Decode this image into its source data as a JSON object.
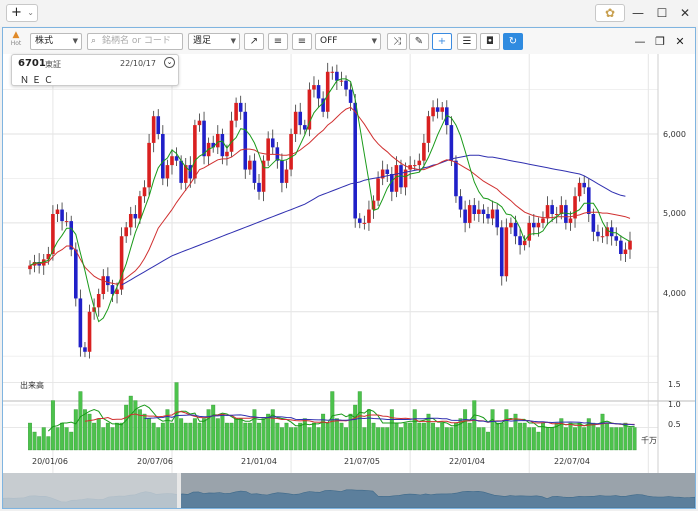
{
  "app": {
    "new_tab_label": "+",
    "window_buttons": [
      "—",
      "☐",
      "✕"
    ]
  },
  "toolbar": {
    "asset_type": "株式",
    "search_placeholder": "銘柄名 or コード",
    "period": "週足",
    "indicator": "OFF"
  },
  "info": {
    "code": "6701",
    "market": "東証",
    "date": "22/10/17",
    "name": "ＮＥＣ"
  },
  "axes": {
    "price_ticks": [
      "6,000",
      "5,000",
      "4,000"
    ],
    "volume_title": "出来高",
    "volume_ticks": [
      "1.5",
      "1.0",
      "0.5"
    ],
    "volume_unit": "千万",
    "date_ticks": [
      "20/01/06",
      "20/07/06",
      "21/01/04",
      "21/07/05",
      "22/01/04",
      "22/07/04"
    ]
  },
  "colors": {
    "up": "#d92020",
    "down": "#2020c8",
    "ma_short": "#1a9a1a",
    "ma_mid": "#d03030",
    "ma_long": "#3030b0",
    "volume": "#4cc24c",
    "accent": "#2f8be0"
  },
  "chart_data": {
    "type": "candlestick",
    "title": "",
    "xlabel": "",
    "ylabel": "",
    "ylim": [
      3300,
      6900
    ],
    "volume_ylim": [
      0,
      1.6
    ],
    "x_start": "2019-12-02",
    "x_end": "2022-10-17",
    "series": [
      {
        "name": "price_close_weekly",
        "values": [
          4520,
          4560,
          4520,
          4590,
          4650,
          5100,
          5150,
          5020,
          5020,
          4700,
          4150,
          3600,
          3550,
          4000,
          4050,
          4200,
          4400,
          4300,
          4200,
          4250,
          4850,
          4950,
          5100,
          5050,
          5300,
          5400,
          5900,
          6200,
          6000,
          5500,
          5650,
          5750,
          5700,
          5450,
          5650,
          5500,
          6100,
          6150,
          5750,
          5900,
          5850,
          6000,
          5750,
          5800,
          6150,
          6350,
          6250,
          5600,
          5700,
          5450,
          5350,
          5700,
          5950,
          5850,
          5700,
          5450,
          5600,
          6000,
          6250,
          6100,
          6050,
          6500,
          6550,
          6400,
          6250,
          6700,
          6700,
          6600,
          6600,
          6500,
          6350,
          5050,
          5000,
          5000,
          5150,
          5250,
          5500,
          5600,
          5550,
          5350,
          5650,
          5400,
          5600,
          5650,
          5650,
          5700,
          5900,
          6200,
          6300,
          6250,
          6300,
          6100,
          5700,
          5300,
          5150,
          5000,
          5200,
          5100,
          5150,
          5100,
          5050,
          5150,
          4950,
          4400,
          4950,
          5000,
          4850,
          4750,
          4800,
          5000,
          4950,
          5000,
          5050,
          5200,
          5100,
          5100,
          5200,
          5000,
          5050,
          5300,
          5450,
          5400,
          5100,
          4900,
          4850,
          4850,
          4950,
          4850,
          4800,
          4650,
          4700,
          4800
        ]
      },
      {
        "name": "ma_short",
        "values": [
          4520,
          4550,
          4550,
          4560,
          4580,
          4690,
          4790,
          4860,
          4940,
          4940,
          4870,
          4660,
          4460,
          4240,
          4050,
          3890,
          3930,
          4030,
          4170,
          4280,
          4400,
          4540,
          4720,
          4890,
          5020,
          5160,
          5300,
          5480,
          5620,
          5690,
          5730,
          5820,
          5780,
          5700,
          5630,
          5580,
          5700,
          5750,
          5780,
          5830,
          5850,
          5910,
          5920,
          5840,
          5910,
          5960,
          6060,
          6050,
          5990,
          5900,
          5770,
          5620,
          5620,
          5670,
          5720,
          5700,
          5710,
          5740,
          5770,
          5880,
          5990,
          6130,
          6240,
          6300,
          6350,
          6440,
          6520,
          6600,
          6620,
          6620,
          6590,
          6390,
          6080,
          5770,
          5470,
          5140,
          5160,
          5270,
          5390,
          5470,
          5520,
          5530,
          5520,
          5550,
          5560,
          5570,
          5640,
          5740,
          5860,
          5990,
          6100,
          6210,
          6180,
          6100,
          5980,
          5810,
          5630,
          5460,
          5350,
          5280,
          5270,
          5240,
          5220,
          5180,
          5100,
          5090,
          5040,
          4940,
          4800,
          4870,
          4880,
          4880,
          4910,
          4990,
          5030,
          5070,
          5110,
          5110,
          5100,
          5120,
          5150,
          5220,
          5220,
          5220,
          5140,
          5010,
          4920,
          4890,
          4890,
          4850,
          4820,
          4790
        ]
      },
      {
        "name": "ma_mid",
        "values": [
          4520,
          4540,
          4540,
          4550,
          4560,
          4620,
          4670,
          4700,
          4740,
          4740,
          4690,
          4590,
          4500,
          4450,
          4400,
          4370,
          4350,
          4330,
          4320,
          4310,
          4340,
          4380,
          4420,
          4460,
          4520,
          4600,
          4700,
          4820,
          4940,
          5010,
          5080,
          5150,
          5230,
          5300,
          5370,
          5440,
          5520,
          5600,
          5620,
          5650,
          5680,
          5710,
          5720,
          5720,
          5740,
          5780,
          5820,
          5830,
          5830,
          5820,
          5790,
          5780,
          5770,
          5770,
          5770,
          5760,
          5760,
          5770,
          5790,
          5820,
          5860,
          5900,
          5950,
          6000,
          6040,
          6100,
          6140,
          6190,
          6240,
          6280,
          6300,
          6250,
          6180,
          6110,
          6030,
          5950,
          5890,
          5840,
          5800,
          5750,
          5710,
          5670,
          5640,
          5620,
          5610,
          5600,
          5600,
          5620,
          5640,
          5660,
          5690,
          5710,
          5700,
          5680,
          5650,
          5620,
          5590,
          5550,
          5510,
          5470,
          5440,
          5410,
          5380,
          5330,
          5290,
          5250,
          5200,
          5160,
          5120,
          5100,
          5080,
          5070,
          5060,
          5060,
          5060,
          5070,
          5070,
          5070,
          5070,
          5080,
          5090,
          5110,
          5120,
          5120,
          5120,
          5110,
          5110,
          5100,
          5090,
          5080,
          5070,
          5050
        ]
      },
      {
        "name": "ma_long",
        "values": [
          null,
          null,
          null,
          null,
          null,
          null,
          null,
          null,
          null,
          null,
          null,
          null,
          null,
          null,
          null,
          null,
          null,
          null,
          null,
          null,
          4300,
          4330,
          4360,
          4390,
          4420,
          4450,
          4480,
          4510,
          4540,
          4570,
          4600,
          4630,
          4650,
          4670,
          4690,
          4710,
          4730,
          4750,
          4770,
          4790,
          4810,
          4830,
          4850,
          4870,
          4890,
          4910,
          4930,
          4950,
          4970,
          4990,
          5010,
          5030,
          5050,
          5070,
          5090,
          5110,
          5130,
          5150,
          5170,
          5190,
          5210,
          5240,
          5270,
          5300,
          5320,
          5340,
          5360,
          5380,
          5400,
          5420,
          5440,
          5450,
          5460,
          5480,
          5490,
          5500,
          5510,
          5520,
          5530,
          5540,
          5550,
          5560,
          5570,
          5580,
          5590,
          5600,
          5620,
          5630,
          5650,
          5660,
          5680,
          5700,
          5720,
          5730,
          5740,
          5750,
          5760,
          5760,
          5760,
          5750,
          5740,
          5740,
          5730,
          5720,
          5710,
          5700,
          5690,
          5680,
          5670,
          5660,
          5650,
          5640,
          5630,
          5620,
          5610,
          5600,
          5590,
          5580,
          5570,
          5560,
          5550,
          5530,
          5500,
          5470,
          5440,
          5410,
          5380,
          5350,
          5330,
          5310,
          5300
        ]
      },
      {
        "name": "volume",
        "values": [
          0.6,
          0.4,
          0.3,
          0.5,
          0.3,
          1.1,
          0.5,
          0.6,
          0.5,
          0.4,
          0.9,
          1.3,
          0.9,
          0.8,
          0.6,
          0.7,
          0.5,
          0.6,
          0.5,
          0.6,
          0.6,
          1.0,
          1.2,
          1.1,
          0.9,
          0.8,
          0.7,
          0.6,
          0.5,
          0.6,
          0.9,
          0.6,
          1.5,
          0.7,
          0.6,
          0.6,
          0.7,
          0.6,
          0.7,
          0.9,
          1.0,
          0.7,
          0.8,
          0.6,
          0.6,
          0.7,
          0.7,
          0.6,
          0.6,
          0.9,
          0.6,
          0.7,
          0.8,
          0.9,
          0.6,
          0.5,
          0.6,
          0.5,
          0.5,
          0.6,
          0.7,
          0.5,
          0.6,
          0.5,
          0.8,
          0.6,
          1.3,
          0.7,
          0.6,
          0.5,
          0.8,
          1.0,
          1.3,
          0.5,
          0.9,
          0.6,
          0.5,
          0.5,
          0.5,
          0.9,
          0.6,
          0.5,
          0.6,
          0.6,
          0.9,
          0.6,
          0.6,
          0.8,
          0.6,
          0.5,
          0.6,
          0.5,
          0.5,
          0.6,
          0.7,
          0.9,
          0.6,
          1.1,
          0.5,
          0.5,
          0.4,
          0.9,
          0.6,
          0.6,
          0.9,
          0.5,
          0.8,
          0.6,
          0.6,
          0.5,
          0.5,
          0.4,
          0.6,
          0.5,
          0.5,
          0.6,
          0.7,
          0.5,
          0.6,
          0.5,
          0.6,
          0.5,
          0.7,
          0.6,
          0.5,
          0.8,
          0.6,
          0.5,
          0.5,
          0.5,
          0.6,
          0.5,
          0.5
        ]
      }
    ]
  }
}
